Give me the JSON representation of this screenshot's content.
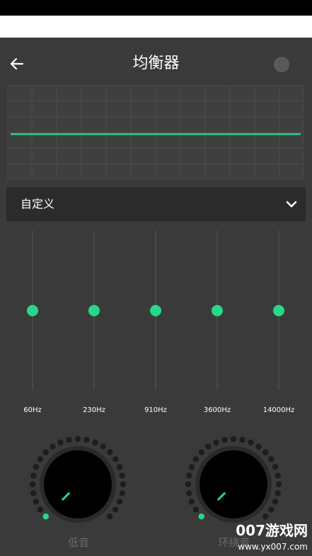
{
  "toolbar": {
    "back_icon": "arrow-left-icon",
    "title": "均衡器",
    "toggle_icon": "power-toggle-icon"
  },
  "graph": {
    "curve_color": "#26d98a",
    "levels": [
      0,
      0,
      0,
      0,
      0
    ],
    "range": [
      -15,
      15
    ]
  },
  "preset": {
    "label": "自定义",
    "icon": "chevron-down-icon"
  },
  "bands": [
    {
      "label": "60Hz",
      "level": 0.5
    },
    {
      "label": "230Hz",
      "level": 0.5
    },
    {
      "label": "910Hz",
      "level": 0.5
    },
    {
      "label": "3600Hz",
      "level": 0.5
    },
    {
      "label": "14000Hz",
      "level": 0.5
    }
  ],
  "knobs": [
    {
      "label": "低音",
      "value": 0
    },
    {
      "label": "环绕音",
      "value": 0
    }
  ],
  "colors": {
    "accent": "#26d98a",
    "background": "#3a3a3a",
    "panel": "#2b2b2b"
  },
  "watermark": {
    "main": "007游戏网",
    "sub": "www.yx007.com"
  }
}
